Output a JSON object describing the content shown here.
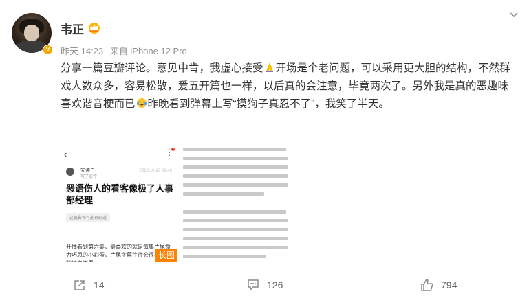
{
  "post": {
    "username": "韦正",
    "time": "昨天 14:23",
    "source": "来自 iPhone 12 Pro",
    "text_part1": "分享一篇豆瓣评论。意见中肯，我虚心接受",
    "text_part2": "开场是个老问题，可以采用更大胆的结构，不然群戏人数众多，容易松散，爱五开篇也一样，以后真的会注意，毕竟两次了。另外我是真的恶趣味喜欢谐音梗而已",
    "text_part3": "昨晚看到弹幕上写“摸狗子真忍不了”，我笑了半天。",
    "emoji1_icon": "praying-hands-icon",
    "emoji2_icon": "laugh-cry-icon"
  },
  "image1": {
    "back": "‹",
    "more": "⋮",
    "author": "安涛白",
    "author_sub": "写了影评",
    "date": "2022-10-20 01:42",
    "title": "恶语伤人的看客像极了人事部经理",
    "tag": "这篇影评可能有剧透",
    "body": "开播看到第六集，最喜欢的就是每集片尾命力巧思的小彩蛋，片尾字幕往往会很不起眼跳过去不看。",
    "badge": "长图"
  },
  "actions": {
    "share_count": "14",
    "comment_count": "126",
    "like_count": "794"
  },
  "colors": {
    "accent": "#ff8200",
    "verified": "#f7a500",
    "meta": "#939393"
  }
}
